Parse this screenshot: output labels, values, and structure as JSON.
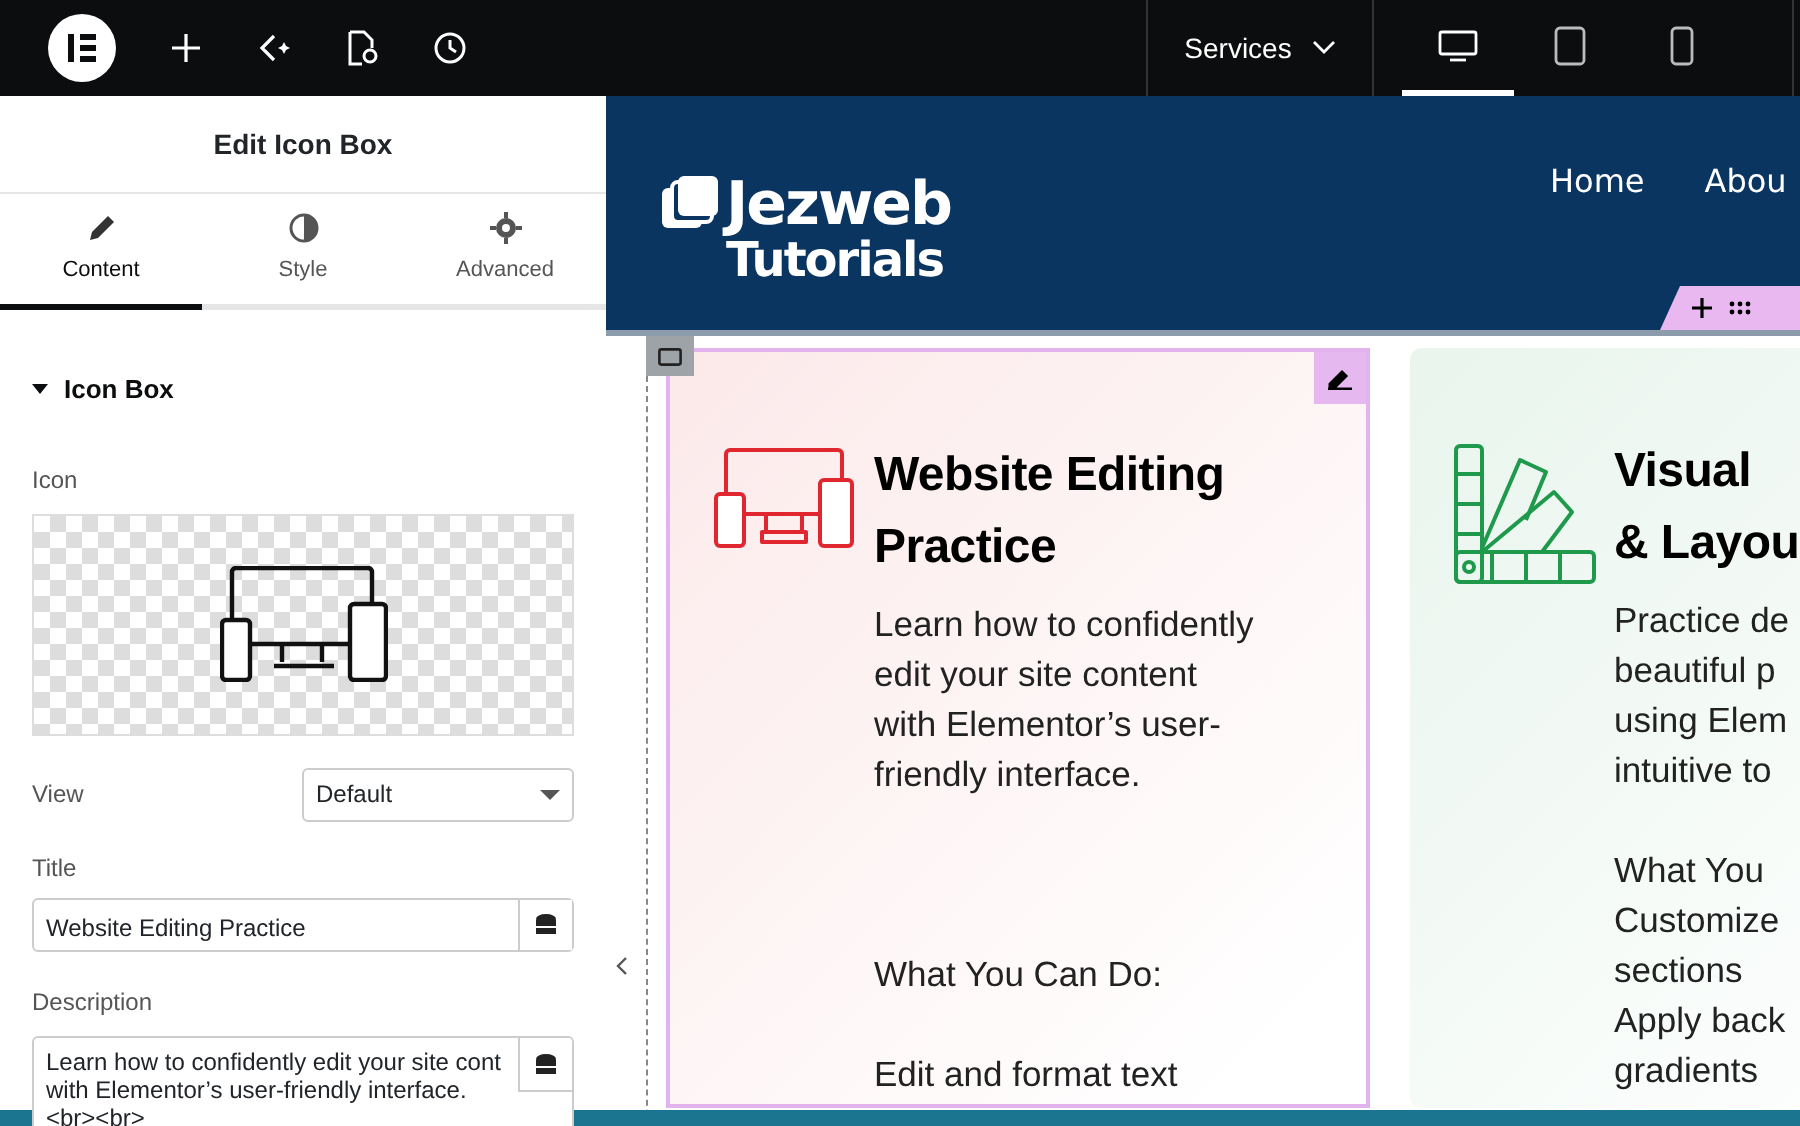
{
  "topbar": {
    "page_menu": "Services",
    "devices": [
      {
        "kind": "desktop",
        "selected": true
      },
      {
        "kind": "tablet",
        "selected": false
      },
      {
        "kind": "mobile",
        "selected": false
      }
    ]
  },
  "panel": {
    "title": "Edit Icon Box",
    "tabs": [
      {
        "label": "Content",
        "kind": "content",
        "selected": true
      },
      {
        "label": "Style",
        "kind": "style",
        "selected": false
      },
      {
        "label": "Advanced",
        "kind": "advanced",
        "selected": false
      }
    ],
    "section": {
      "title": "Icon Box",
      "expanded": true
    },
    "icon_label": "Icon",
    "view": {
      "label": "View",
      "value": "Default"
    },
    "title_field": {
      "label": "Title",
      "value": "Website Editing Practice"
    },
    "description_field": {
      "label": "Description",
      "value": "Learn how to confidently edit your site cont\nwith Elementor’s user-friendly interface.\n<br><br>"
    }
  },
  "site": {
    "logo": [
      "Jezweb",
      "Tutorials"
    ],
    "nav": [
      "Home",
      "Abou"
    ],
    "cards": [
      {
        "color": "#e0262f",
        "selected": true,
        "title": [
          "Website Editing",
          "Practice"
        ],
        "blocks": [
          {
            "kind": "text",
            "lines": [
              "Learn how to confidently",
              "edit your site content",
              "with Elementor’s user-",
              "friendly interface."
            ]
          },
          {
            "kind": "break"
          },
          {
            "kind": "break"
          },
          {
            "kind": "break"
          },
          {
            "kind": "text",
            "lines": [
              "What You Can Do:"
            ]
          },
          {
            "kind": "break"
          },
          {
            "kind": "text",
            "lines": [
              "Edit and format text"
            ]
          }
        ]
      },
      {
        "color": "#1f9a4c",
        "selected": false,
        "title": [
          "Visual",
          "& Layou"
        ],
        "blocks": [
          {
            "kind": "text",
            "lines": [
              "Practice de",
              "beautiful p",
              "using Elem",
              "intuitive to"
            ]
          },
          {
            "kind": "break"
          },
          {
            "kind": "text",
            "lines": [
              "What You",
              "Customize",
              "sections",
              "Apply back",
              "gradients"
            ]
          }
        ]
      }
    ]
  }
}
